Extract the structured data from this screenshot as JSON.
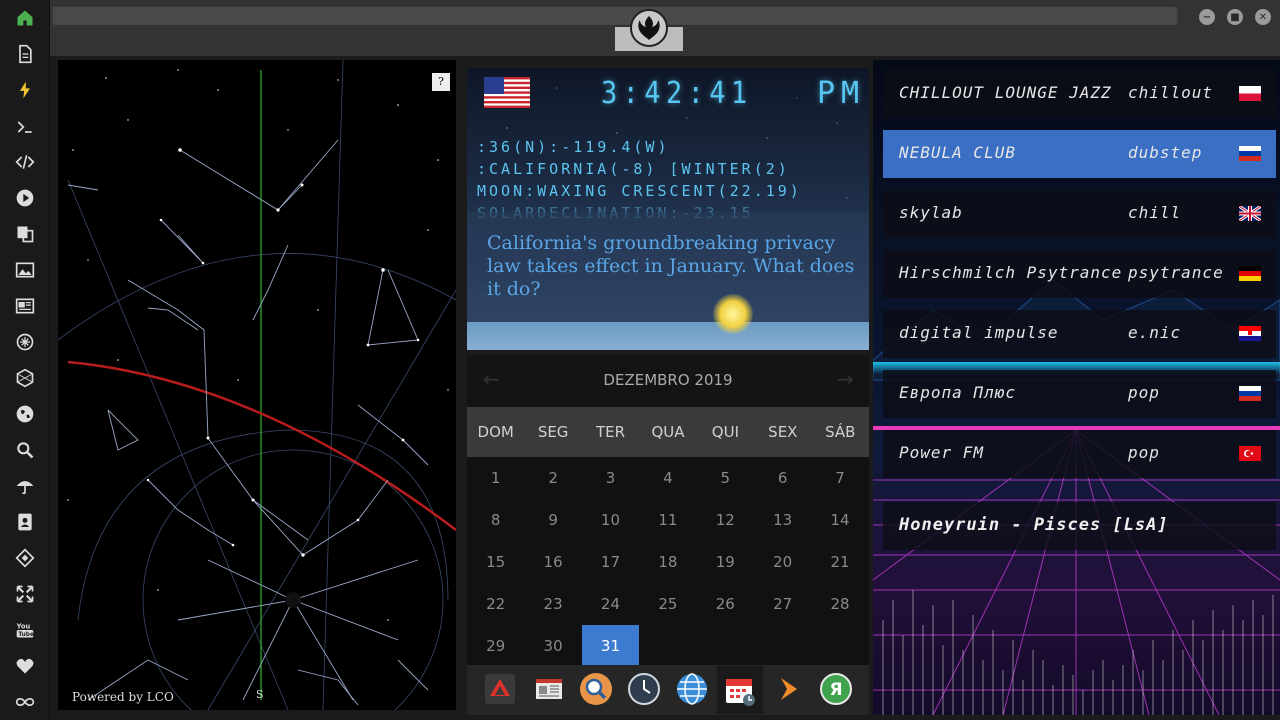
{
  "rail": {
    "icons": [
      "home-icon",
      "document-icon",
      "bolt-icon",
      "terminal-icon",
      "code-icon",
      "play-icon",
      "translate-icon",
      "image-icon",
      "newspaper-icon",
      "settings-icon",
      "hexagon-icon",
      "globe-icon",
      "search-icon",
      "umbrella-icon",
      "contacts-icon",
      "extension-icon",
      "fullscreen-icon",
      "youtube-icon",
      "heart-icon",
      "infinity-icon"
    ]
  },
  "window": {
    "controls": [
      "minimize",
      "maximize",
      "close"
    ]
  },
  "skymap": {
    "help_label": "?",
    "powered_by": "Powered by LCO",
    "compass_south": "S"
  },
  "clock": {
    "time": "3:42:41",
    "ampm": "PM",
    "coords": ":36(N):-119.4(W)",
    "region": ":CALIFORNIA(-8) [WINTER(2)",
    "moon": "MOON:WAXING CRESCENT(22.19)",
    "solar": "SOLARDECLINATION:-23.15",
    "news": "California's groundbreaking privacy law takes effect in January. What does it do?"
  },
  "calendar": {
    "title": "DEZEMBRO 2019",
    "prev": "←",
    "next": "→",
    "weekdays": [
      "DOM",
      "SEG",
      "TER",
      "QUA",
      "QUI",
      "SEX",
      "SÁB"
    ],
    "weeks": [
      [
        "1",
        "2",
        "3",
        "4",
        "5",
        "6",
        "7"
      ],
      [
        "8",
        "9",
        "10",
        "11",
        "12",
        "13",
        "14"
      ],
      [
        "15",
        "16",
        "17",
        "18",
        "19",
        "20",
        "21"
      ],
      [
        "22",
        "23",
        "24",
        "25",
        "26",
        "27",
        "28"
      ],
      [
        "29",
        "30",
        "31",
        "",
        "",
        "",
        ""
      ]
    ],
    "today": "31"
  },
  "dock": {
    "items": [
      "anydesk-icon",
      "news-icon",
      "search-icon",
      "clock-icon",
      "browser-icon",
      "calendar-icon",
      "play-store-icon",
      "yandex-icon"
    ]
  },
  "radio": {
    "stations": [
      {
        "name": "CHILLOUT LOUNGE JAZZ",
        "genre": "chillout",
        "flag": "pl"
      },
      {
        "name": "NEBULA CLUB",
        "genre": "dubstep",
        "flag": "ru"
      },
      {
        "name": "skylab",
        "genre": "chill",
        "flag": "gb"
      },
      {
        "name": "Hirschmilch Psytrance",
        "genre": "psytrance",
        "flag": "de"
      },
      {
        "name": "digital impulse",
        "genre": "e.nic",
        "flag": "hr"
      },
      {
        "name": "Европа Плюс",
        "genre": "pop",
        "flag": "ru"
      },
      {
        "name": "Power FM",
        "genre": "pop",
        "flag": "tr"
      }
    ],
    "selected": "NEBULA CLUB",
    "now_playing": "Honeyruin - Pisces [LsA]"
  },
  "colors": {
    "accent": "#3d7bd1",
    "clock_text": "#57c6f2",
    "today": "#3d7bd1"
  }
}
